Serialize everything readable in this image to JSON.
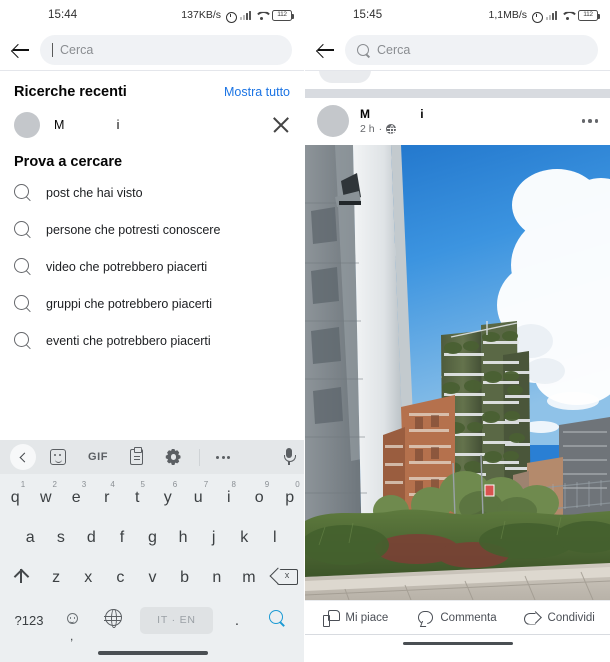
{
  "left": {
    "status": {
      "time": "15:44",
      "speed": "137KB/s",
      "battery_level": "112",
      "icons": [
        "alarm-icon",
        "signal-icon",
        "wifi-icon",
        "battery-icon"
      ]
    },
    "search": {
      "placeholder": "Cerca",
      "value": ""
    },
    "recent": {
      "title": "Ricerche recenti",
      "show_all": "Mostra tutto",
      "items": [
        {
          "name_start": "M",
          "name_end": "i"
        }
      ]
    },
    "try": {
      "title": "Prova a cercare",
      "suggestions": [
        "post che hai visto",
        "persone che potresti conoscere",
        "video che potrebbero piacerti",
        "gruppi che potrebbero piacerti",
        "eventi che potrebbero piacerti"
      ]
    },
    "keyboard": {
      "toolbar": [
        "back-icon",
        "sticker-icon",
        "GIF",
        "clipboard-icon",
        "gear-icon",
        "more-icon",
        "mic-icon"
      ],
      "gif_label": "GIF",
      "row1": [
        {
          "k": "q",
          "n": "1"
        },
        {
          "k": "w",
          "n": "2"
        },
        {
          "k": "e",
          "n": "3"
        },
        {
          "k": "r",
          "n": "4"
        },
        {
          "k": "t",
          "n": "5"
        },
        {
          "k": "y",
          "n": "6"
        },
        {
          "k": "u",
          "n": "7"
        },
        {
          "k": "i",
          "n": "8"
        },
        {
          "k": "o",
          "n": "9"
        },
        {
          "k": "p",
          "n": "0"
        }
      ],
      "row2": [
        "a",
        "s",
        "d",
        "f",
        "g",
        "h",
        "j",
        "k",
        "l"
      ],
      "row3": [
        "z",
        "x",
        "c",
        "v",
        "b",
        "n",
        "m"
      ],
      "numeric_label": "?123",
      "space_label": "IT · EN",
      "period_label": ".",
      "comma_label": ",",
      "backspace_x": "x"
    }
  },
  "right": {
    "status": {
      "time": "15:45",
      "speed": "1,1MB/s",
      "battery_level": "112",
      "icons": [
        "alarm-icon",
        "signal-icon",
        "wifi-icon",
        "battery-icon"
      ]
    },
    "search": {
      "placeholder": "Cerca",
      "value": ""
    },
    "post": {
      "author_start": "M",
      "author_end": "i",
      "time": "2 h",
      "privacy_icon": "globe-icon",
      "menu_icon": "more-options-icon",
      "photo_alt": "Bosco Verticale residential towers in Milan under a blue sky with clouds"
    },
    "actions": [
      {
        "label": "Mi piace",
        "icon": "thumbs-up-icon"
      },
      {
        "label": "Commenta",
        "icon": "comment-bubble-icon"
      },
      {
        "label": "Condividi",
        "icon": "share-arrow-icon"
      }
    ]
  },
  "colors": {
    "accent_link": "#1b74e4",
    "search_cyan": "#1b9ad4",
    "pill_bg": "#f0f2f5",
    "keyboard_bg": "#eceff1",
    "feed_divider": "#d8dbe0"
  }
}
